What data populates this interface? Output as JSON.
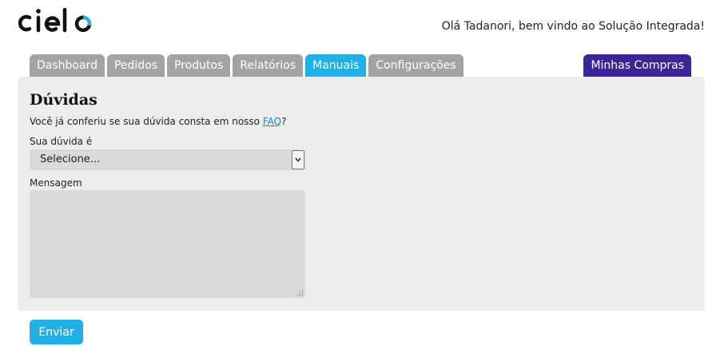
{
  "header": {
    "logo_text": "cielo",
    "greeting": "Olá Tadanori, bem vindo ao Solução Integrada!"
  },
  "nav": {
    "tabs": [
      {
        "label": "Dashboard",
        "active": false
      },
      {
        "label": "Pedidos",
        "active": false
      },
      {
        "label": "Produtos",
        "active": false
      },
      {
        "label": "Relatórios",
        "active": false
      },
      {
        "label": "Manuais",
        "active": true
      },
      {
        "label": "Configurações",
        "active": false
      }
    ],
    "purchases_label": "Minhas Compras"
  },
  "form": {
    "title": "Dúvidas",
    "intro_text": "Você já conferiu se sua dúvida consta em nosso ",
    "faq_link": "FAQ",
    "intro_suffix": "?",
    "question_label": "Sua dúvida é",
    "question_value": "Selecione...",
    "message_label": "Mensagem",
    "message_value": "",
    "submit_label": "Enviar"
  },
  "colors": {
    "tab_inactive": "#a3a3a3",
    "tab_active": "#1fb1e6",
    "purchases": "#3d2597",
    "panel": "#ededed",
    "button": "#1fb1e6"
  }
}
